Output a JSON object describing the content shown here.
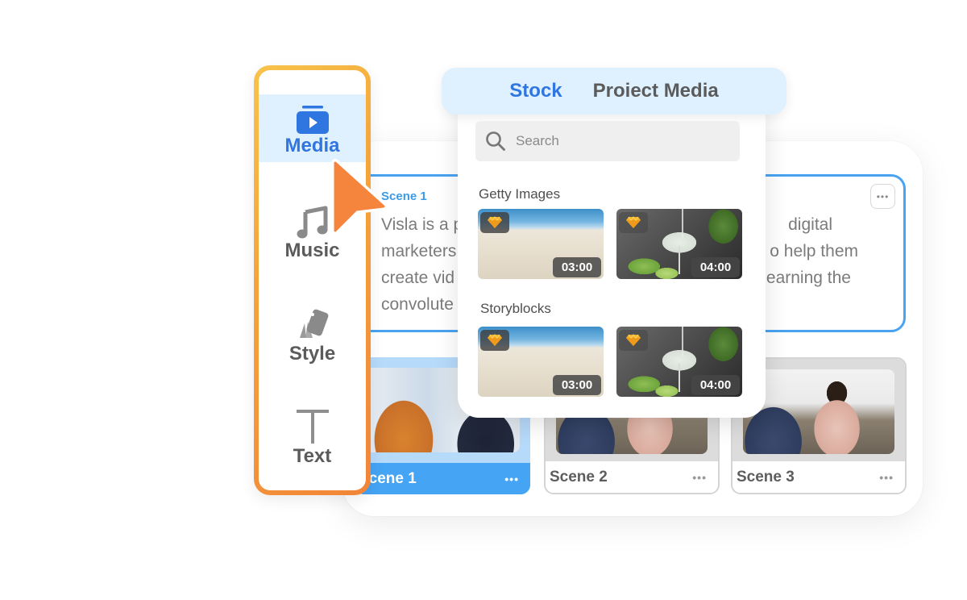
{
  "sidebar": {
    "items": [
      {
        "label": "Media",
        "icon": "media-play-icon",
        "active": true
      },
      {
        "label": "Music",
        "icon": "music-note-icon",
        "active": false
      },
      {
        "label": "Style",
        "icon": "swatch-cards-icon",
        "active": false
      },
      {
        "label": "Text",
        "icon": "text-t-icon",
        "active": false
      }
    ]
  },
  "media_panel": {
    "tabs": [
      {
        "label": "Stock",
        "active": true
      },
      {
        "label": "Proiect Media",
        "active": false
      }
    ],
    "search": {
      "placeholder": "Search",
      "value": ""
    },
    "sections": [
      {
        "title": "Getty Images",
        "items": [
          {
            "thumbnail": "desert-dunes",
            "duration": "03:00",
            "premium": true
          },
          {
            "thumbnail": "cocktail-pour",
            "duration": "04:00",
            "premium": true
          }
        ]
      },
      {
        "title": "Storyblocks",
        "items": [
          {
            "thumbnail": "desert-dunes",
            "duration": "03:00",
            "premium": true
          },
          {
            "thumbnail": "cocktail-pour",
            "duration": "04:00",
            "premium": true
          }
        ]
      }
    ]
  },
  "script_block": {
    "scene_label": "Scene 1",
    "text_left_lines": [
      "Visla is a p",
      "marketers",
      "create vid",
      "convolute"
    ],
    "text_right_lines": [
      "digital",
      "o help them",
      "earning the",
      ""
    ],
    "more_label": "•••"
  },
  "scenes": [
    {
      "label": "Scene 1",
      "active": true,
      "thumbnail": "office-meeting",
      "more_label": "•••"
    },
    {
      "label": "Scene 2",
      "active": false,
      "thumbnail": "women-on-couch",
      "more_label": "•••"
    },
    {
      "label": "Scene 3",
      "active": false,
      "thumbnail": "women-on-couch",
      "more_label": "•••"
    }
  ],
  "colors": {
    "accent_blue": "#2f76e0",
    "scene_blue": "#45a4f4",
    "cursor_orange": "#f5843c",
    "sidebar_border_start": "#f7c34b",
    "sidebar_border_end": "#f28438",
    "premium_gem": "#f5b323"
  }
}
